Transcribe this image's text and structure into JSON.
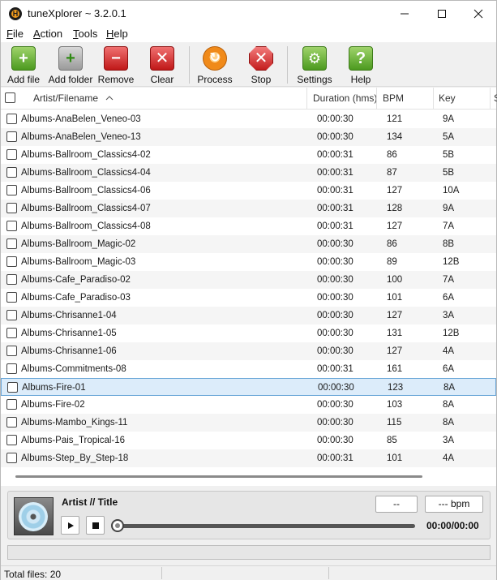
{
  "window": {
    "title": "tuneXplorer ~ 3.2.0.1",
    "app_icon_letter": "H"
  },
  "menu": [
    {
      "label": "File",
      "accel": "F",
      "rest": "ile"
    },
    {
      "label": "Action",
      "accel": "A",
      "rest": "ction"
    },
    {
      "label": "Tools",
      "accel": "T",
      "rest": "ools"
    },
    {
      "label": "Help",
      "accel": "H",
      "rest": "elp"
    }
  ],
  "toolbar": {
    "add_file": "Add file",
    "add_folder": "Add folder",
    "remove": "Remove",
    "clear": "Clear",
    "process": "Process",
    "stop": "Stop",
    "settings": "Settings",
    "help": "Help"
  },
  "columns": {
    "name": "Artist/Filename",
    "duration": "Duration (hms)",
    "bpm": "BPM",
    "key": "Key",
    "extra": "S"
  },
  "rows": [
    {
      "name": "Albums-AnaBelen_Veneo-03",
      "duration": "00:00:30",
      "bpm": "121",
      "key": "9A"
    },
    {
      "name": "Albums-AnaBelen_Veneo-13",
      "duration": "00:00:30",
      "bpm": "134",
      "key": "5A"
    },
    {
      "name": "Albums-Ballroom_Classics4-02",
      "duration": "00:00:31",
      "bpm": "86",
      "key": "5B"
    },
    {
      "name": "Albums-Ballroom_Classics4-04",
      "duration": "00:00:31",
      "bpm": "87",
      "key": "5B"
    },
    {
      "name": "Albums-Ballroom_Classics4-06",
      "duration": "00:00:31",
      "bpm": "127",
      "key": "10A"
    },
    {
      "name": "Albums-Ballroom_Classics4-07",
      "duration": "00:00:31",
      "bpm": "128",
      "key": "9A"
    },
    {
      "name": "Albums-Ballroom_Classics4-08",
      "duration": "00:00:31",
      "bpm": "127",
      "key": "7A"
    },
    {
      "name": "Albums-Ballroom_Magic-02",
      "duration": "00:00:30",
      "bpm": "86",
      "key": "8B"
    },
    {
      "name": "Albums-Ballroom_Magic-03",
      "duration": "00:00:30",
      "bpm": "89",
      "key": "12B"
    },
    {
      "name": "Albums-Cafe_Paradiso-02",
      "duration": "00:00:30",
      "bpm": "100",
      "key": "7A"
    },
    {
      "name": "Albums-Cafe_Paradiso-03",
      "duration": "00:00:30",
      "bpm": "101",
      "key": "6A"
    },
    {
      "name": "Albums-Chrisanne1-04",
      "duration": "00:00:30",
      "bpm": "127",
      "key": "3A"
    },
    {
      "name": "Albums-Chrisanne1-05",
      "duration": "00:00:30",
      "bpm": "131",
      "key": "12B"
    },
    {
      "name": "Albums-Chrisanne1-06",
      "duration": "00:00:30",
      "bpm": "127",
      "key": "4A"
    },
    {
      "name": "Albums-Commitments-08",
      "duration": "00:00:31",
      "bpm": "161",
      "key": "6A"
    },
    {
      "name": "Albums-Fire-01",
      "duration": "00:00:30",
      "bpm": "123",
      "key": "8A"
    },
    {
      "name": "Albums-Fire-02",
      "duration": "00:00:30",
      "bpm": "103",
      "key": "8A"
    },
    {
      "name": "Albums-Mambo_Kings-11",
      "duration": "00:00:30",
      "bpm": "115",
      "key": "8A"
    },
    {
      "name": "Albums-Pais_Tropical-16",
      "duration": "00:00:30",
      "bpm": "85",
      "key": "3A"
    },
    {
      "name": "Albums-Step_By_Step-18",
      "duration": "00:00:31",
      "bpm": "101",
      "key": "4A"
    }
  ],
  "selected_row": "Albums-Fire-01",
  "player": {
    "title": "Artist // Title",
    "key_display": "--",
    "bpm_display": "--- bpm",
    "time": "00:00/00:00"
  },
  "status": {
    "total_files": "Total files: 20"
  },
  "colors": {
    "selection": "#dcecfa",
    "selection_border": "#6ba7d8",
    "accent_orange": "#f29b1d"
  }
}
